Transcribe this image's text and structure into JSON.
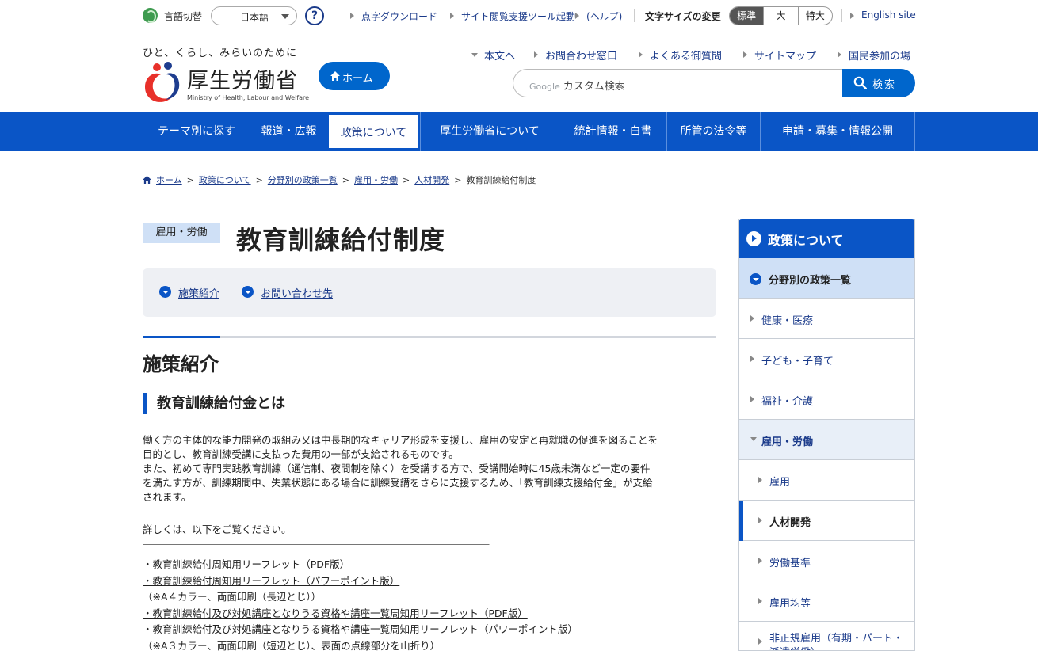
{
  "utility": {
    "lang_label": "言語切替",
    "lang_value": "日本語",
    "help_glyph": "?",
    "links": [
      "点字ダウンロード",
      "サイト閲覧支援ツール起動",
      "(ヘルプ)"
    ],
    "font_size_label": "文字サイズの変更",
    "font_sizes": [
      "標準",
      "大",
      "特大"
    ],
    "english": "English site"
  },
  "header": {
    "tagline": "ひと、くらし、みらいのために",
    "logo_text": "厚生労働省",
    "logo_en": "Ministry of Health, Labour and Welfare",
    "home_label": "ホーム",
    "links": [
      "本文へ",
      "お問合わせ窓口",
      "よくある御質問",
      "サイトマップ",
      "国民参加の場"
    ],
    "search_google": "Google",
    "search_placeholder": "カスタム検索",
    "search_button": "検索"
  },
  "gnav": [
    "テーマ別に探す",
    "報道・広報",
    "政策について",
    "厚生労働省について",
    "統計情報・白書",
    "所管の法令等",
    "申請・募集・情報公開"
  ],
  "breadcrumb": [
    "ホーム",
    "政策について",
    "分野別の政策一覧",
    "雇用・労働",
    "人材開発",
    "教育訓練給付制度"
  ],
  "main": {
    "category": "雇用・労働",
    "title": "教育訓練給付制度",
    "anchors": [
      "施策紹介",
      "お問い合わせ先"
    ],
    "h2": "施策紹介",
    "h3": "教育訓練給付金とは",
    "para1_l1": "働く方の主体的な能力開発の取組み又は中長期的なキャリア形成を支援し、雇用の安定と再就職の促進を図ることを",
    "para1_l2": "目的とし、教育訓練受講に支払った費用の一部が支給されるものです。",
    "para1_l3": "また、初めて専門実践教育訓練（通信制、夜間制を除く）を受講する方で、受講開始時に45歳未満など一定の要件",
    "para1_l4": "を満たす方が、訓練期間中、失業状態にある場合に訓練受講をさらに支援するため、「教育訓練支援給付金」が支給",
    "para1_l5": "されます。",
    "para2": "詳しくは、以下をご覧ください。",
    "divider": "―――――――――――――――――――――――――――――――――――",
    "docs": [
      "・教育訓練給付周知用リーフレット（PDF版）",
      "・教育訓練給付周知用リーフレット（パワーポイント版）",
      "（※A４カラー、両面印刷（長辺とじ））",
      "・教育訓練給付及び対処講座となりうる資格や講座一覧周知用リーフレット（PDF版）",
      "・教育訓練給付及び対処講座となりうる資格や講座一覧周知用リーフレット（パワーポイント版）",
      "（※A３カラー、両面印刷（短辺とじ）、表面の点線部分を山折り）"
    ]
  },
  "sidebar": {
    "heading": "政策について",
    "sub": "分野別の政策一覧",
    "items": [
      "健康・医療",
      "子ども・子育て",
      "福祉・介護",
      "雇用・労働",
      "雇用",
      "人材開発",
      "労働基準",
      "雇用均等",
      "非正規雇用（有期・パート・派遣労働）"
    ]
  }
}
